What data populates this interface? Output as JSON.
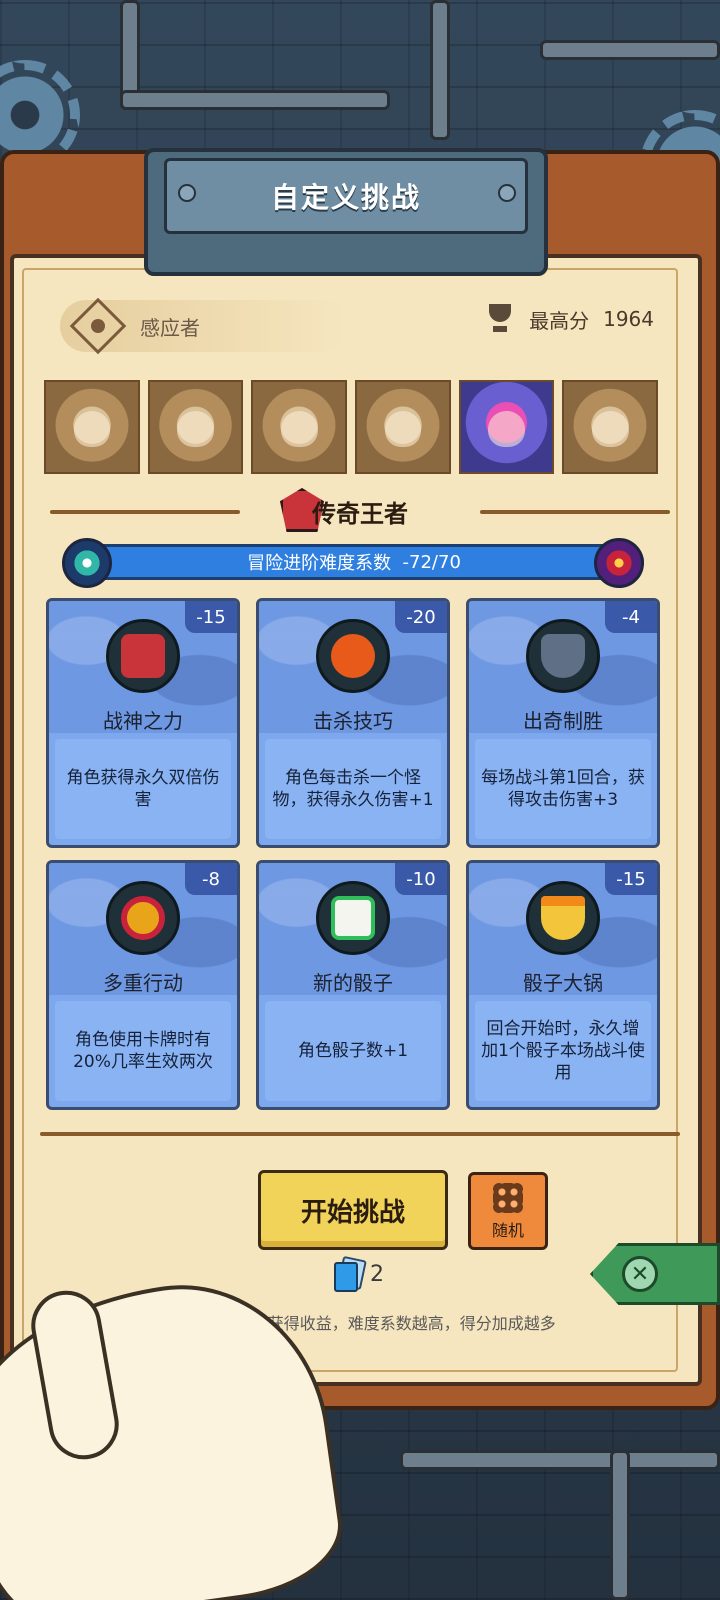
{
  "header": {
    "title": "自定义挑战"
  },
  "hero": {
    "name": "感应者",
    "icon": "eye-icon"
  },
  "best_score": {
    "label": "最高分",
    "value": "1964",
    "icon": "trophy-icon"
  },
  "portraits": [
    {
      "name": "portrait-1",
      "selected": false
    },
    {
      "name": "portrait-2",
      "selected": false
    },
    {
      "name": "portrait-3",
      "selected": false
    },
    {
      "name": "portrait-4",
      "selected": false
    },
    {
      "name": "portrait-5",
      "selected": true
    },
    {
      "name": "portrait-6",
      "selected": false
    }
  ],
  "rank": {
    "title": "传奇王者",
    "icon": "crown-badge-icon"
  },
  "difficulty": {
    "label": "冒险进阶难度系数",
    "value": "-72/70"
  },
  "cards": [
    {
      "badge": "-15",
      "name": "战神之力",
      "desc": "角色获得永久双倍伤害",
      "color": "#c8343a"
    },
    {
      "badge": "-20",
      "name": "击杀技巧",
      "desc": "角色每击杀一个怪物，获得永久伤害+1",
      "color": "#e85a1a"
    },
    {
      "badge": "-4",
      "name": "出奇制胜",
      "desc": "每场战斗第1回合，获得攻击伤害+3",
      "color": "#5f6f86"
    },
    {
      "badge": "-8",
      "name": "多重行动",
      "desc": "角色使用卡牌时有20%几率生效两次",
      "color": "#e8a51a"
    },
    {
      "badge": "-10",
      "name": "新的骰子",
      "desc": "角色骰子数+1",
      "color": "#2fbf5a"
    },
    {
      "badge": "-15",
      "name": "骰子大锅",
      "desc": "回合开始时，永久增加1个骰子本场战斗使用",
      "color": "#f28a1a"
    }
  ],
  "buttons": {
    "start": "开始挑战",
    "random": "随机"
  },
  "deck": {
    "count": "2"
  },
  "hint": "难度系数>0可获得收益，难度系数越高，得分加成越多"
}
